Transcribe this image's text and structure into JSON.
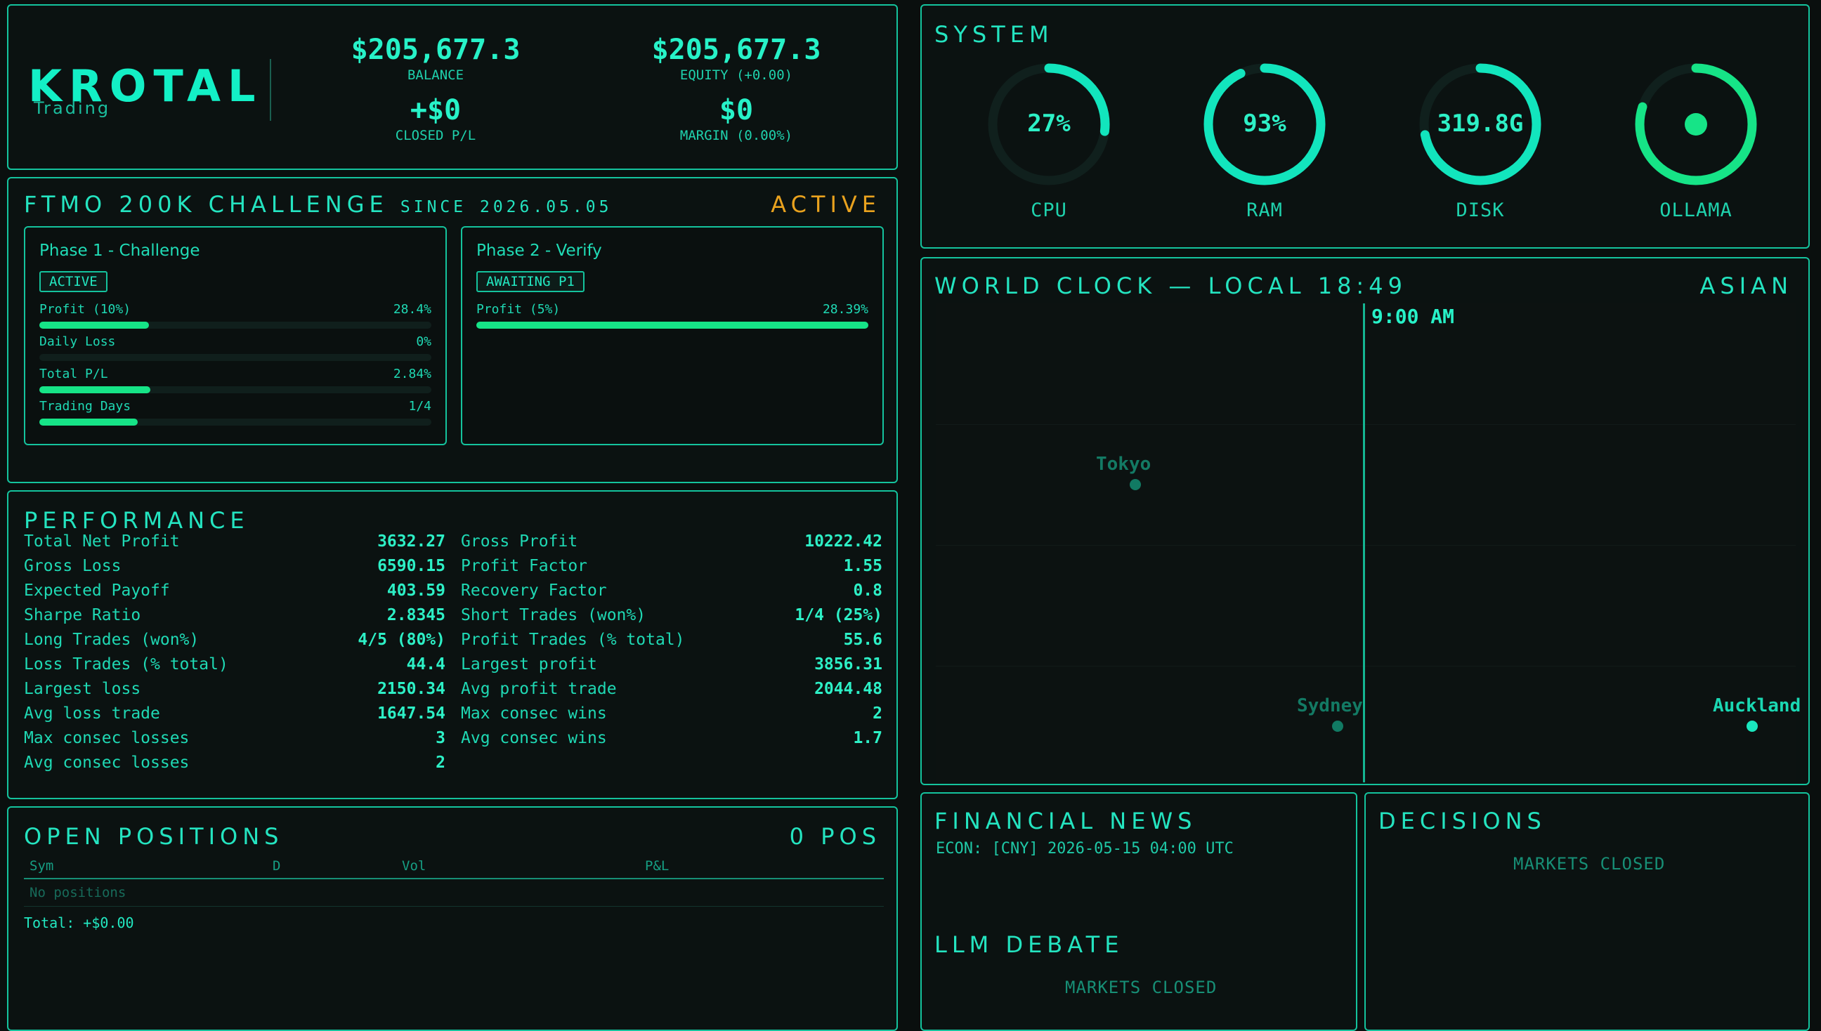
{
  "header": {
    "logo": "KROTAL",
    "logo_sub": "Trading",
    "balance_value": "$205,677.3",
    "balance_label": "BALANCE",
    "equity_value": "$205,677.3",
    "equity_label": "EQUITY (+0.00)",
    "closed_pl_value": "+$0",
    "closed_pl_label": "CLOSED P/L",
    "margin_value": "$0",
    "margin_label": "MARGIN (0.00%)"
  },
  "challenge": {
    "title": "FTMO 200K CHALLENGE",
    "since": "SINCE 2026.05.05",
    "status": "ACTIVE",
    "phase1": {
      "title": "Phase 1 - Challenge",
      "badge": "ACTIVE",
      "metrics": [
        {
          "label": "Profit (10%)",
          "value": "28.4%",
          "progress": 0.28
        },
        {
          "label": "Daily Loss",
          "value": "0%",
          "progress": 0.0
        },
        {
          "label": "Total P/L",
          "value": "2.84%",
          "progress": 0.284
        },
        {
          "label": "Trading Days",
          "value": "1/4",
          "progress": 0.25
        }
      ]
    },
    "phase2": {
      "title": "Phase 2 - Verify",
      "badge": "AWAITING P1",
      "metrics": [
        {
          "label": "Profit (5%)",
          "value": "28.39%",
          "progress": 1.0
        }
      ]
    }
  },
  "performance": {
    "title": "PERFORMANCE",
    "left": [
      {
        "label": "Total Net Profit",
        "value": "3632.27"
      },
      {
        "label": "Gross Loss",
        "value": "6590.15"
      },
      {
        "label": "Expected Payoff",
        "value": "403.59"
      },
      {
        "label": "Sharpe Ratio",
        "value": "2.8345"
      },
      {
        "label": "Long Trades (won%)",
        "value": "4/5 (80%)"
      },
      {
        "label": "Loss Trades (% total)",
        "value": "44.4"
      },
      {
        "label": "Largest loss",
        "value": "2150.34"
      },
      {
        "label": "Avg loss trade",
        "value": "1647.54"
      },
      {
        "label": "Max consec losses",
        "value": "3"
      },
      {
        "label": "Avg consec losses",
        "value": "2"
      }
    ],
    "right": [
      {
        "label": "Gross Profit",
        "value": "10222.42"
      },
      {
        "label": "Profit Factor",
        "value": "1.55"
      },
      {
        "label": "Recovery Factor",
        "value": "0.8"
      },
      {
        "label": "Short Trades (won%)",
        "value": "1/4 (25%)"
      },
      {
        "label": "Profit Trades (% total)",
        "value": "55.6"
      },
      {
        "label": "Largest profit",
        "value": "3856.31"
      },
      {
        "label": "Avg profit trade",
        "value": "2044.48"
      },
      {
        "label": "Max consec wins",
        "value": "2"
      },
      {
        "label": "Avg consec wins",
        "value": "1.7"
      }
    ]
  },
  "positions": {
    "title": "OPEN POSITIONS",
    "count": "0 POS",
    "columns": [
      "Sym",
      "D",
      "Vol",
      "P&L"
    ],
    "empty": "No positions",
    "total": "Total: +$0.00"
  },
  "system": {
    "title": "SYSTEM",
    "gauges": [
      {
        "label": "CPU",
        "value": "27%",
        "level": 0.27,
        "color": "#12e5bd"
      },
      {
        "label": "RAM",
        "value": "93%",
        "level": 0.93,
        "color": "#12e5bd"
      },
      {
        "label": "DISK",
        "value": "319.8G",
        "level": 0.72,
        "color": "#12e5bd"
      },
      {
        "label": "OLLAMA",
        "value": "",
        "level": 0.8,
        "color": "#16e487"
      }
    ]
  },
  "world_clock": {
    "title": "WORLD CLOCK — LOCAL 18:49",
    "session": "ASIAN",
    "marker_time": "9:00 AM",
    "cities": [
      {
        "name": "Tokyo",
        "active": false
      },
      {
        "name": "Sydney",
        "active": false
      },
      {
        "name": "Auckland",
        "active": true
      }
    ]
  },
  "news": {
    "title": "FINANCIAL NEWS",
    "item": "ECON: [CNY] 2026-05-15 04:00 UTC"
  },
  "debate": {
    "title": "LLM DEBATE",
    "status": "MARKETS CLOSED"
  },
  "decisions": {
    "title": "DECISIONS",
    "status": "MARKETS CLOSED"
  },
  "colors": {
    "accent": "#12e5bd",
    "progress": "#16e487",
    "warning": "#e9a21e",
    "background": "#0a0f0e"
  }
}
